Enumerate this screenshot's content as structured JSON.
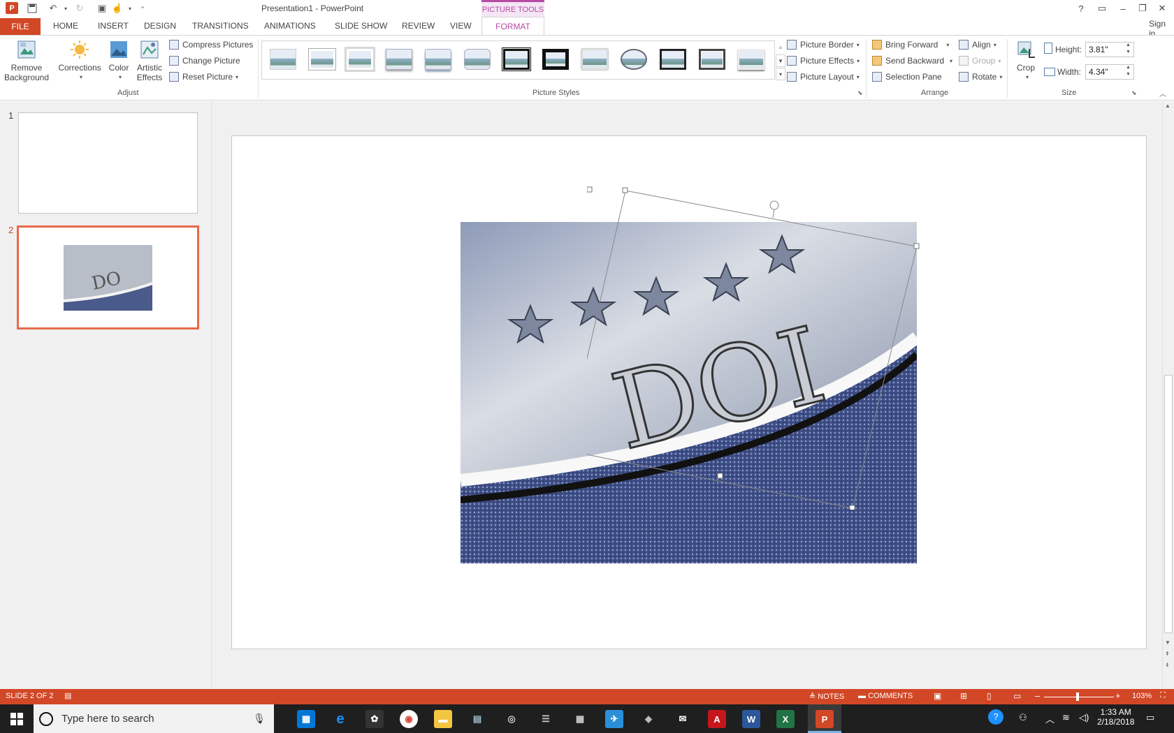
{
  "window": {
    "title": "Presentation1 - PowerPoint",
    "help": "?",
    "sign_in": "Sign in"
  },
  "tabs": {
    "file": "FILE",
    "items": [
      "HOME",
      "INSERT",
      "DESIGN",
      "TRANSITIONS",
      "ANIMATIONS",
      "SLIDE SHOW",
      "REVIEW",
      "VIEW"
    ],
    "contextual_group": "PICTURE TOOLS",
    "active": "FORMAT"
  },
  "ribbon": {
    "adjust": {
      "label": "Adjust",
      "remove_background_1": "Remove",
      "remove_background_2": "Background",
      "corrections": "Corrections",
      "color": "Color",
      "artistic_effects_1": "Artistic",
      "artistic_effects_2": "Effects",
      "compress_pictures": "Compress Pictures",
      "change_picture": "Change Picture",
      "reset_picture": "Reset Picture"
    },
    "picture_styles": {
      "label": "Picture Styles",
      "picture_border": "Picture Border",
      "picture_effects": "Picture Effects",
      "picture_layout": "Picture Layout"
    },
    "arrange": {
      "label": "Arrange",
      "bring_forward": "Bring Forward",
      "send_backward": "Send Backward",
      "selection_pane": "Selection Pane",
      "align": "Align",
      "group": "Group",
      "rotate": "Rotate"
    },
    "size": {
      "label": "Size",
      "crop": "Crop",
      "height_label": "Height:",
      "height_value": "3.81\"",
      "width_label": "Width:",
      "width_value": "4.34\""
    }
  },
  "slides": {
    "numbers": [
      "1",
      "2"
    ],
    "selected": 2,
    "picture_text": "DOI"
  },
  "status": {
    "slide_info": "SLIDE 2 OF 2",
    "notes": "NOTES",
    "comments": "COMMENTS",
    "zoom": "103%"
  },
  "taskbar": {
    "search_placeholder": "Type here to search",
    "time": "1:33 AM",
    "date": "2/18/2018"
  },
  "colors": {
    "accent": "#d24726",
    "picture_tools": "#b64aa5",
    "taskbar": "#1f1f1f"
  }
}
